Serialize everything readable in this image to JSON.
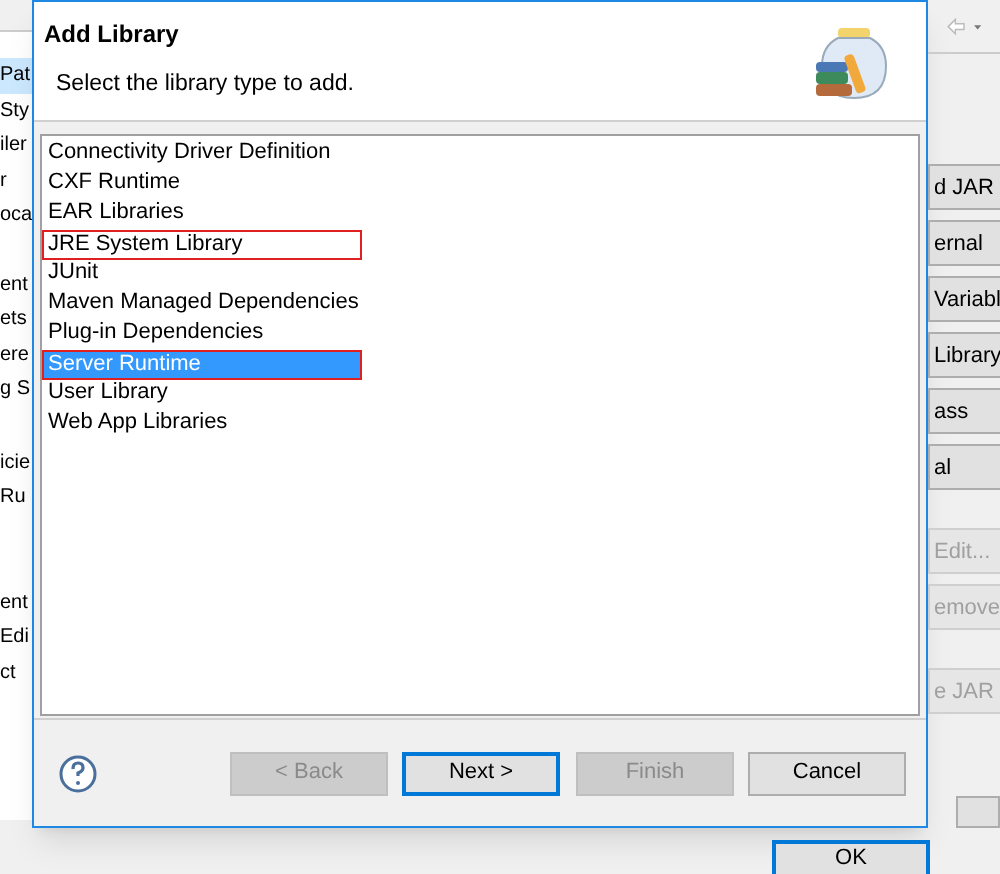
{
  "background_window": {
    "left_labels": [
      {
        "text": "Pat",
        "selected": true
      },
      {
        "text": "Sty",
        "selected": false
      },
      {
        "text": "iler",
        "selected": false
      },
      {
        "text": "r",
        "selected": false
      },
      {
        "text": "oca",
        "selected": false
      },
      {
        "text": "ent",
        "selected": false
      },
      {
        "text": "ets",
        "selected": false
      },
      {
        "text": "ere",
        "selected": false
      },
      {
        "text": "g S",
        "selected": false
      },
      {
        "text": "icie",
        "selected": false
      },
      {
        "text": "Ru",
        "selected": false
      },
      {
        "text": "ent",
        "selected": false
      },
      {
        "text": "Edi",
        "selected": false
      },
      {
        "text": "ct",
        "selected": false
      }
    ],
    "right_buttons": [
      {
        "label": "d JAR",
        "disabled": false
      },
      {
        "label": "ernal",
        "disabled": false
      },
      {
        "label": "Variabl",
        "disabled": false
      },
      {
        "label": "Library",
        "disabled": false
      },
      {
        "label": "ass",
        "disabled": false
      },
      {
        "label": "al",
        "disabled": false
      },
      {
        "label": "Edit...",
        "disabled": true
      },
      {
        "label": "emove",
        "disabled": true
      },
      {
        "label": "e JAR",
        "disabled": true
      }
    ],
    "ok_button": "OK"
  },
  "dialog": {
    "title": "Add Library",
    "subtitle": "Select the library type to add.",
    "items": [
      {
        "label": "Connectivity Driver Definition",
        "selected": false,
        "annotated": false
      },
      {
        "label": "CXF Runtime",
        "selected": false,
        "annotated": false
      },
      {
        "label": "EAR Libraries",
        "selected": false,
        "annotated": false
      },
      {
        "label": "JRE System Library",
        "selected": false,
        "annotated": true
      },
      {
        "label": "JUnit",
        "selected": false,
        "annotated": false
      },
      {
        "label": "Maven Managed Dependencies",
        "selected": false,
        "annotated": false
      },
      {
        "label": "Plug-in Dependencies",
        "selected": false,
        "annotated": false
      },
      {
        "label": "Server Runtime",
        "selected": true,
        "annotated": true
      },
      {
        "label": "User Library",
        "selected": false,
        "annotated": false
      },
      {
        "label": "Web App Libraries",
        "selected": false,
        "annotated": false
      }
    ],
    "buttons": [
      {
        "label": "< Back",
        "disabled": true,
        "focused": false
      },
      {
        "label": "Next >",
        "disabled": false,
        "focused": true
      },
      {
        "label": "Finish",
        "disabled": true,
        "focused": false
      },
      {
        "label": "Cancel",
        "disabled": false,
        "focused": false
      }
    ]
  }
}
